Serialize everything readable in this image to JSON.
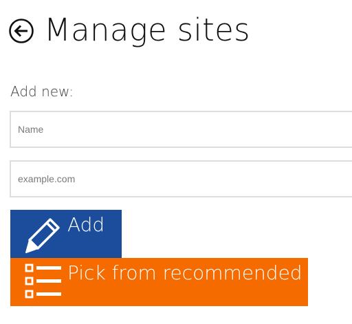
{
  "header": {
    "title": "Manage sites",
    "back_icon": "back-arrow-circle-icon"
  },
  "form": {
    "section_label": "Add new:",
    "name_field": {
      "placeholder": "Name",
      "value": ""
    },
    "url_field": {
      "placeholder": "example.com",
      "value": ""
    }
  },
  "actions": {
    "add": {
      "label": "Add",
      "icon": "pencil-icon",
      "color": "#1b4d9c"
    },
    "recommended": {
      "label": "Pick from recommended",
      "icon": "list-icon",
      "color": "#f56b00"
    }
  }
}
